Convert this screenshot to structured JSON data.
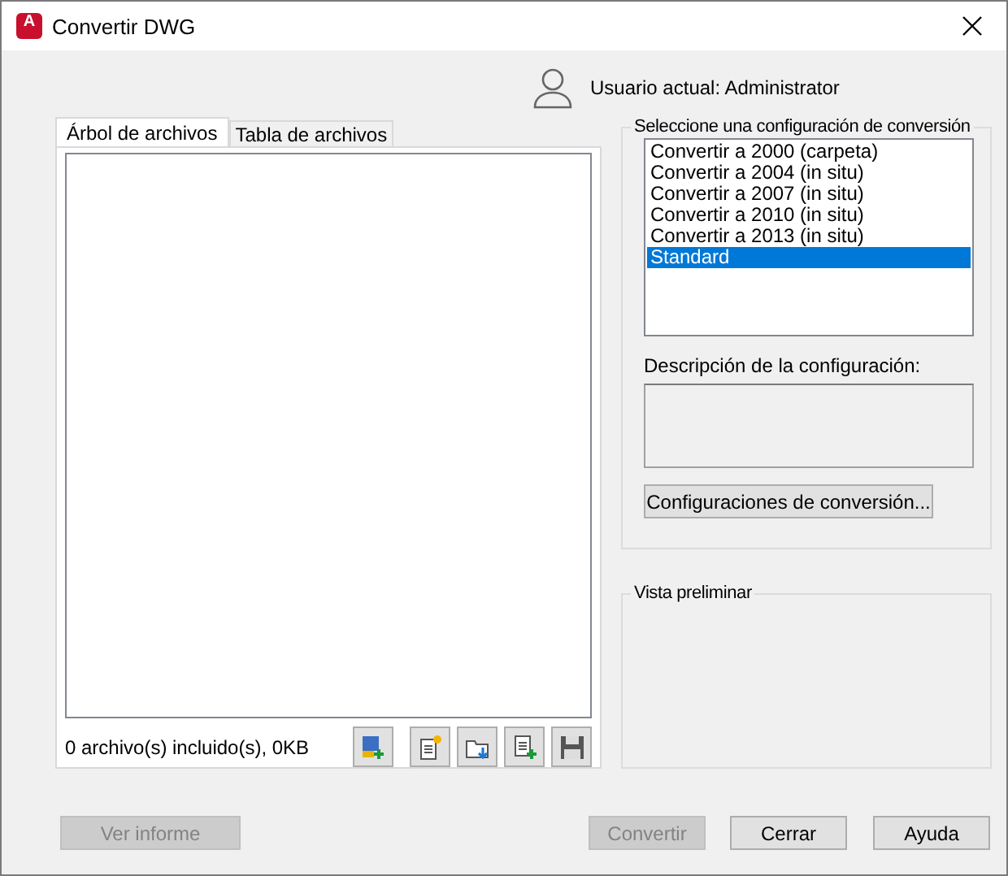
{
  "window": {
    "title": "Convertir DWG",
    "logo": "A"
  },
  "user": {
    "label": "Usuario actual: Administrator"
  },
  "tabs": [
    {
      "label": "Árbol de archivos",
      "selected": true
    },
    {
      "label": "Tabla de archivos",
      "selected": false
    }
  ],
  "status": "0 archivo(s) incluido(s), 0KB",
  "conversion": {
    "title": "Seleccione una configuración de conversión",
    "setups": [
      {
        "label": "Convertir a 2000 (carpeta)",
        "selected": false
      },
      {
        "label": "Convertir a 2004 (in situ)",
        "selected": false
      },
      {
        "label": "Convertir a 2007 (in situ)",
        "selected": false
      },
      {
        "label": "Convertir a 2010 (in situ)",
        "selected": false
      },
      {
        "label": "Convertir a 2013 (in situ)",
        "selected": false
      },
      {
        "label": "Standard",
        "selected": true
      }
    ],
    "description_label": "Descripción de la configuración:",
    "setups_button": "Configuraciones de conversión..."
  },
  "preview": {
    "title": "Vista preliminar"
  },
  "buttons": [
    {
      "label": "Ver informe",
      "disabled": true
    },
    {
      "label": "Convertir",
      "disabled": true
    },
    {
      "label": "Cerrar",
      "disabled": false
    },
    {
      "label": "Ayuda",
      "disabled": false
    }
  ]
}
